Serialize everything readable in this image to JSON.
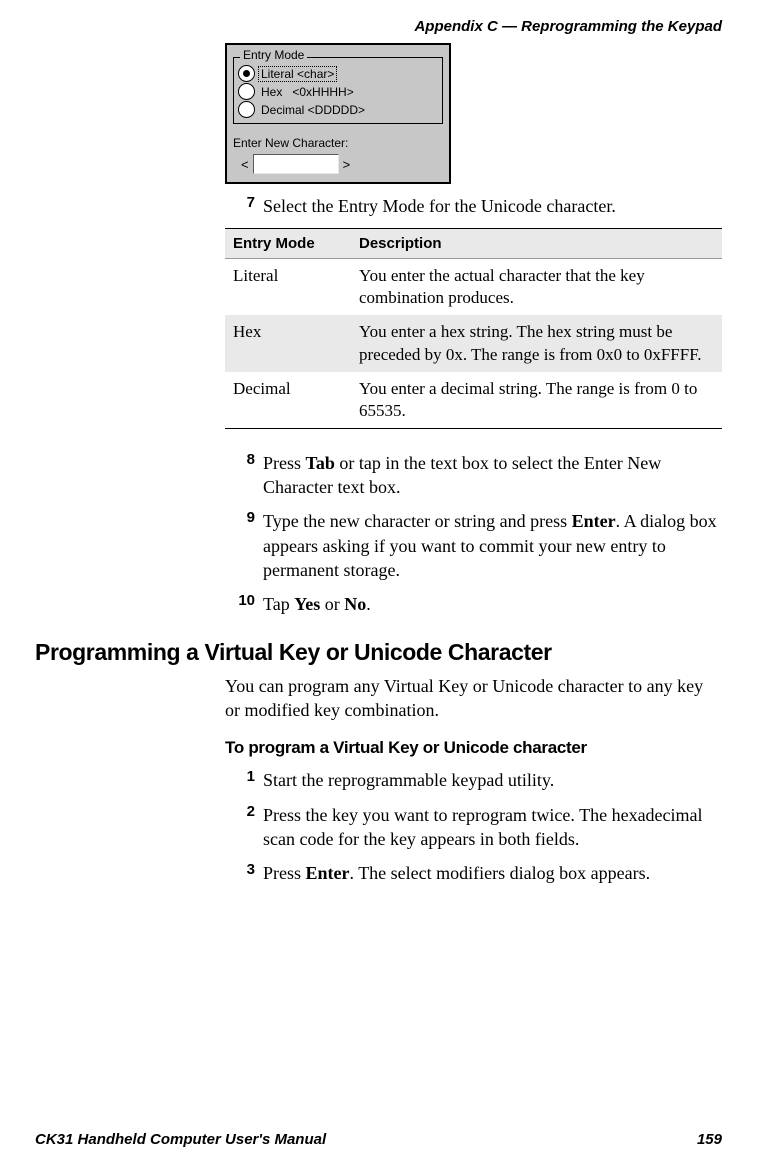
{
  "header": "Appendix C — Reprogramming the Keypad",
  "dialog": {
    "group_label": "Entry Mode",
    "opt_literal": "Literal <char>",
    "opt_hex_prefix": "Hex",
    "opt_hex_suffix": "<0xHHHH>",
    "opt_decimal": "Decimal <DDDDD>",
    "enter_label": "Enter New Character:",
    "lt": "<",
    "gt": ">"
  },
  "steps_a": {
    "s7": {
      "num": "7",
      "text": "Select the Entry Mode for the Unicode character."
    },
    "s8": {
      "num": "8",
      "pre": "Press ",
      "b1": "Tab",
      "post": " or tap in the text box to select the Enter New Character text box."
    },
    "s9": {
      "num": "9",
      "pre": "Type the new character or string and press ",
      "b1": "Enter",
      "post": ". A dialog box appears asking if you want to commit your new entry to permanent storage."
    },
    "s10": {
      "num": "10",
      "pre": "Tap ",
      "b1": "Yes",
      "mid": " or ",
      "b2": "No",
      "post": "."
    }
  },
  "table": {
    "h1": "Entry Mode",
    "h2": "Description",
    "rows": [
      {
        "mode": "Literal",
        "desc": "You enter the actual character that the key combination produces."
      },
      {
        "mode": "Hex",
        "desc": "You enter a hex string. The hex string must be preceded by 0x. The range is from 0x0 to 0xFFFF."
      },
      {
        "mode": "Decimal",
        "desc": "You enter a decimal string. The range is from 0 to 65535."
      }
    ]
  },
  "section_title": "Programming a Virtual Key or Unicode Character",
  "section_body": "You can program any Virtual Key or Unicode character to any key or modified key combination.",
  "sub_title": "To program a Virtual Key or Unicode character",
  "steps_b": {
    "s1": {
      "num": "1",
      "text": "Start the reprogrammable keypad utility."
    },
    "s2": {
      "num": "2",
      "text": "Press the key you want to reprogram twice. The hexadecimal scan code for the key appears in both fields."
    },
    "s3": {
      "num": "3",
      "pre": "Press ",
      "b1": "Enter",
      "post": ". The select modifiers dialog box appears."
    }
  },
  "footer": {
    "left": "CK31 Handheld Computer User's Manual",
    "right": "159"
  }
}
